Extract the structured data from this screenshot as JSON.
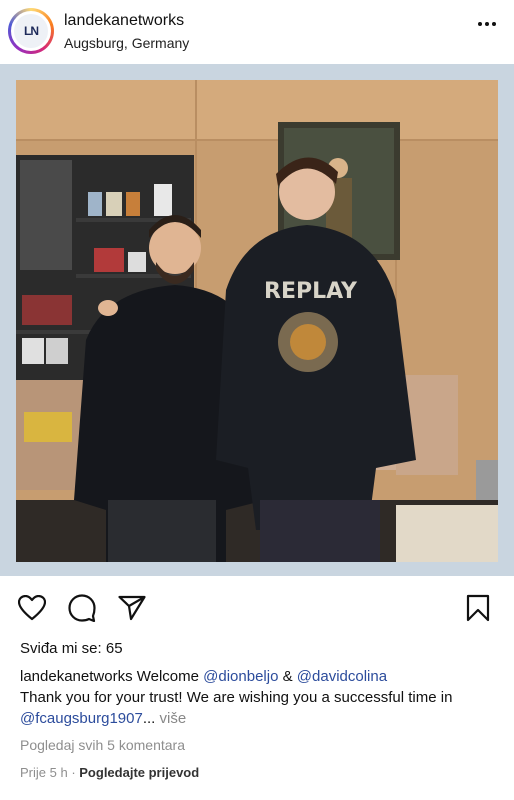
{
  "header": {
    "avatar_text": "LN",
    "username": "landekanetworks",
    "location": "Augsburg, Germany",
    "more_icon": "more-horizontal-icon"
  },
  "post": {
    "image_description_icon": "photo",
    "frame_color": "#c9d5e0",
    "jersey_text": "REPLAY"
  },
  "actions": {
    "like_icon": "heart-icon",
    "comment_icon": "comment-icon",
    "share_icon": "send-icon",
    "save_icon": "bookmark-icon"
  },
  "likes": {
    "label": "Sviđa mi se: 65"
  },
  "caption": {
    "username": "landekanetworks",
    "text1": " Welcome ",
    "mention1": "@dionbeljo",
    "text2": " & ",
    "mention2": "@davidcolina",
    "text3": "Thank you for your trust! We are wishing you a successful time in ",
    "mention3": "@fcaugsburg1907",
    "ellipsis": "... ",
    "more_label": "više"
  },
  "comments": {
    "label": "Pogledaj svih 5 komentara"
  },
  "meta": {
    "time": "Prije 5 h",
    "separator": " · ",
    "translate_label": "Pogledajte prijevod"
  },
  "colors": {
    "mention": "#2c4c9c",
    "muted": "#8e8e8e"
  }
}
